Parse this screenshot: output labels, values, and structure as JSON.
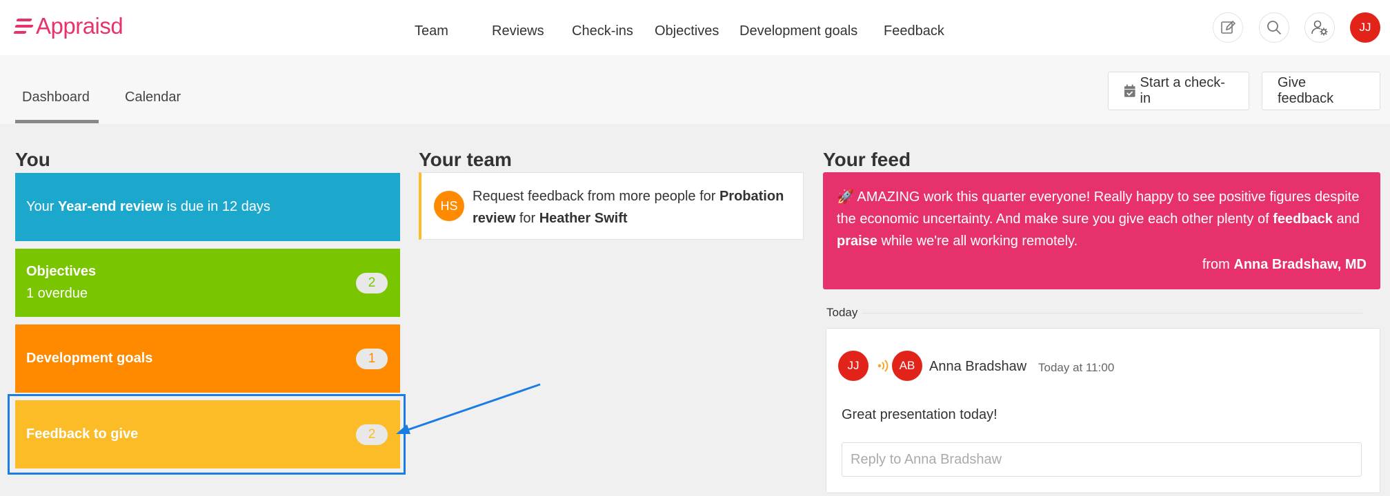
{
  "brand": {
    "name": "Appraisd",
    "color": "#e8336a"
  },
  "nav": {
    "items": [
      "Team",
      "Reviews",
      "Check-ins",
      "Objectives",
      "Development goals",
      "Feedback"
    ],
    "icons": [
      "pencil-icon",
      "search-icon",
      "admin-settings-icon"
    ],
    "user_initials": "JJ"
  },
  "subnav": {
    "tabs": [
      "Dashboard",
      "Calendar"
    ],
    "active_tab": "Dashboard",
    "start_checkin_label": "Start a check-in",
    "give_feedback_label": "Give feedback"
  },
  "you": {
    "title": "You",
    "review": {
      "prefix": "Your ",
      "bold": "Year-end review",
      "suffix": " is due in 12 days",
      "color": "#1ca8cc"
    },
    "objectives": {
      "title": "Objectives",
      "subtitle": "1 overdue",
      "count": "2",
      "color": "#79c600"
    },
    "dev_goals": {
      "title": "Development goals",
      "count": "1",
      "color": "#ff8a00"
    },
    "feedback": {
      "title": "Feedback to give",
      "count": "2",
      "color": "#fbbc28"
    }
  },
  "team": {
    "title": "Your team",
    "item": {
      "initials": "HS",
      "t1": "Request feedback from more people for ",
      "b1": "Probation review",
      "t2": " for ",
      "b2": "Heather Swift"
    }
  },
  "feed": {
    "title": "Your feed",
    "announcement": {
      "emoji": "🚀",
      "t1": " AMAZING work this quarter everyone! Really happy to see positive figures despite the economic uncertainty. And make sure you give each other plenty of ",
      "b1": "feedback",
      "t2": " and ",
      "b2": "praise",
      "t3": " while we're all working remotely.",
      "from_prefix": "from ",
      "from_name": "Anna Bradshaw, MD",
      "color": "#e7316d"
    },
    "today_label": "Today",
    "post": {
      "from_initials": "JJ",
      "to_initials": "AB",
      "name": "Anna Bradshaw",
      "time": "Today at 11:00",
      "message": "Great presentation today!",
      "reply_placeholder": "Reply to Anna Bradshaw"
    }
  }
}
